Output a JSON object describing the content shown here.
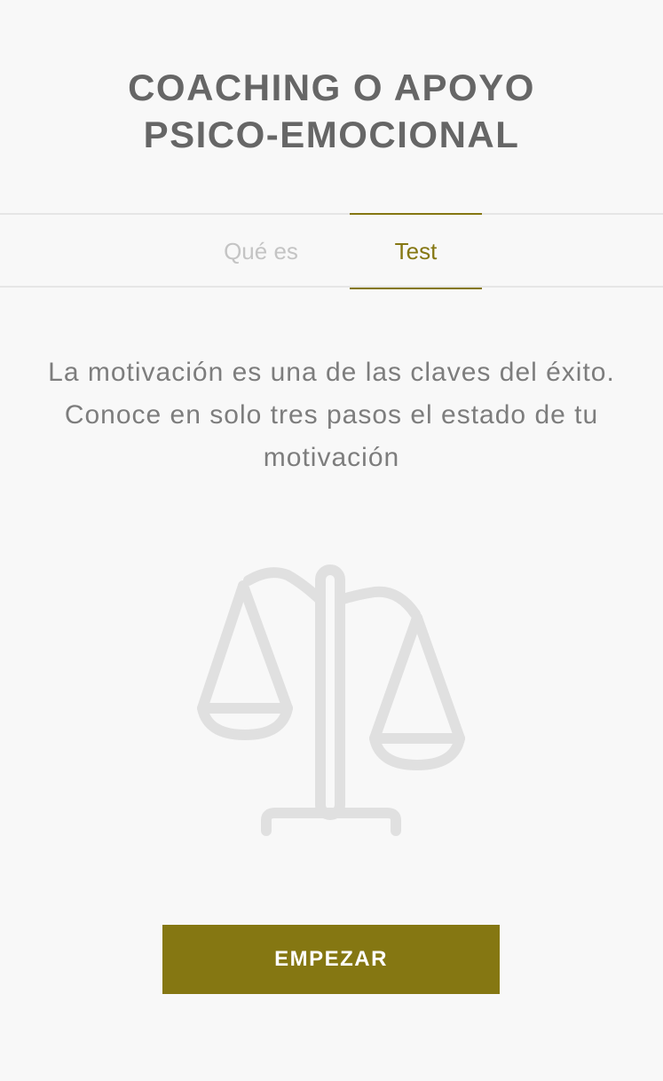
{
  "header": {
    "title_line1": "COACHING O APOYO",
    "title_line2": "PSICO-EMOCIONAL"
  },
  "tabs": [
    {
      "label": "Qué es",
      "active": false
    },
    {
      "label": "Test",
      "active": true
    }
  ],
  "content": {
    "description_line1": "La motivación es una de las claves del éxito.",
    "description_line2": "Conoce en solo tres pasos el estado de tu",
    "description_line3": "motivación",
    "illustration_icon": "balance-scale-icon"
  },
  "actions": {
    "start_label": "EMPEZAR"
  },
  "colors": {
    "accent": "#857712",
    "title": "#666666",
    "text": "#7d7d7d",
    "inactive_tab": "#c4c4c4",
    "icon": "#e0e0e0",
    "background": "#f8f8f8"
  }
}
